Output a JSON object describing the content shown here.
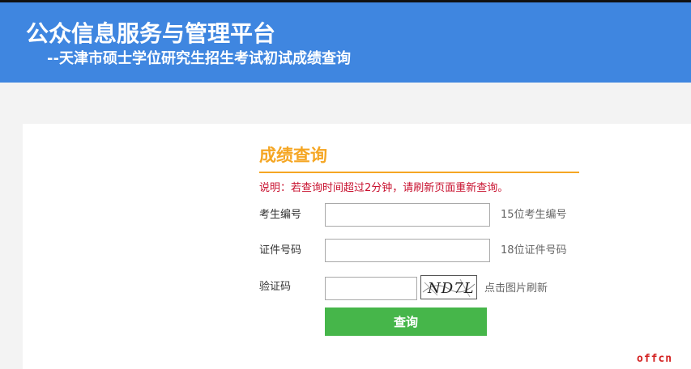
{
  "header": {
    "title": "公众信息服务与管理平台",
    "subtitle": "--天津市硕士学位研究生招生考试初试成绩查询"
  },
  "form": {
    "title": "成绩查询",
    "notice": "说明：若查询时间超过2分钟，请刷新页面重新查询。",
    "exam_id": {
      "label": "考生编号",
      "value": "",
      "hint": "15位考生编号"
    },
    "id_number": {
      "label": "证件号码",
      "value": "",
      "hint": "18位证件号码"
    },
    "captcha": {
      "label": "验证码",
      "value": "",
      "image_text": "ND7L",
      "hint": "点击图片刷新"
    },
    "submit_label": "查询"
  },
  "watermark": "offcn",
  "colors": {
    "header_bg": "#3f86e0",
    "accent_orange": "#f5a623",
    "notice_red": "#c8102e",
    "button_green": "#46b64a"
  }
}
